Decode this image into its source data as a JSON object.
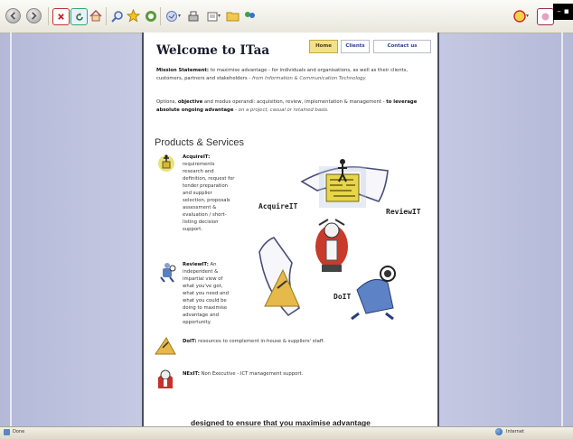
{
  "page": {
    "title": "Welcome to ITaa",
    "nav": [
      "Home",
      "Clients",
      "Contact us"
    ],
    "mission_label": "Mission Statement:",
    "mission_text": " to maximise advantage - for individuals and organisations, as well as their clients, customers, partners and stakeholders - ",
    "mission_italic": "from Information & Communication Technology.",
    "options_1": "Options, ",
    "options_objective": "objective",
    "options_2": " and modus operandi: acquisition, review, implementation & management - ",
    "options_bold": "to leverage absolute ongoing advantage",
    "options_italic": " - on a project, casual or retained basis.",
    "products_heading": "Products & Services",
    "acquire_label": "AcquireIT:",
    "acquire_text": " requirements research and definition, request for tender preparation and supplier selection, proposals assessment & evaluation / short-listing decision support.",
    "review_label": "ReviewIT:",
    "review_text": " An independent & impartial view of what you've got, what you need and what you could be doing to maximise advantage and opportunity.",
    "doit_label": "DoIT:",
    "doit_text": " resources to complement in-house & suppliers' staff.",
    "nexit_label": "NExIT:",
    "nexit_text": " Non Executive - ICT management support.",
    "diagram_labels": [
      "AcquireIT",
      "ReviewIT",
      "DoIT"
    ],
    "tagline": "designed to ensure that you maximise advantage"
  },
  "statusbar": {
    "left": "Done",
    "right": "Internet"
  },
  "colors": {
    "accent_nav": "#2a3e8e",
    "home_tab": "#f3e08a",
    "bg": "#c9cde5"
  }
}
